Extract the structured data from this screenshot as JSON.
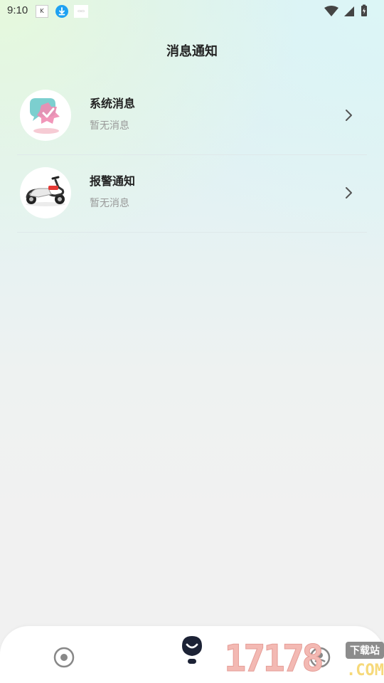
{
  "status_bar": {
    "time": "9:10",
    "app_icons": [
      "app-notification-icon",
      "download-icon",
      "app-thumbnail-icon"
    ],
    "right_icons": [
      "wifi-icon",
      "cellular-signal-icon",
      "battery-charging-icon"
    ]
  },
  "header": {
    "title": "消息通知"
  },
  "messages": [
    {
      "title": "系统消息",
      "subtitle": "暂无消息",
      "icon": "system-message-icon"
    },
    {
      "title": "报警通知",
      "subtitle": "暂无消息",
      "icon": "scooter-icon"
    }
  ],
  "tab_bar": {
    "tabs": [
      {
        "icon": "home-tab-icon",
        "active": false
      },
      {
        "icon": "message-tab-icon",
        "active": true
      },
      {
        "icon": "profile-tab-icon",
        "active": false
      }
    ]
  },
  "watermark": {
    "number": "17178",
    "badge": "下载站",
    "domain": ".COM"
  },
  "colors": {
    "title": "#222222",
    "subtitle": "#999999",
    "active_tab": "#1c2235",
    "inactive_tab": "#888888"
  }
}
